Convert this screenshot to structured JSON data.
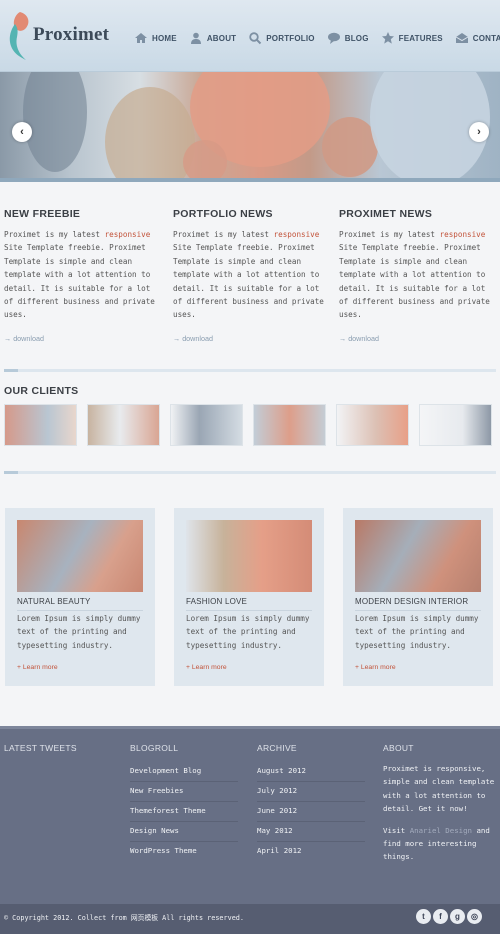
{
  "brand": {
    "name": "Proximet"
  },
  "nav": [
    {
      "label": "HOME",
      "icon": "home-icon"
    },
    {
      "label": "ABOUT",
      "icon": "user-icon"
    },
    {
      "label": "PORTFOLIO",
      "icon": "search-icon"
    },
    {
      "label": "BLOG",
      "icon": "chat-bubble-icon"
    },
    {
      "label": "FEATURES",
      "icon": "star-icon"
    },
    {
      "label": "CONTACT",
      "icon": "envelope-icon"
    }
  ],
  "slider": {
    "prev": "‹",
    "next": "›"
  },
  "columns": [
    {
      "title": "NEW FREEBIE",
      "text_before": "Proximet is my latest ",
      "highlight": "responsive",
      "text_after": " Site Template freebie. Proximet Template is simple and clean template with a lot attention to detail. It is suitable for a lot of different business and private uses.",
      "link": "download"
    },
    {
      "title": "PORTFOLIO NEWS",
      "text_before": "Proximet is my latest ",
      "highlight": "responsive",
      "text_after": " Site Template freebie. Proximet Template is simple and clean template with a lot attention to detail. It is suitable for a lot of different business and private uses.",
      "link": "download"
    },
    {
      "title": "PROXIMET NEWS",
      "text_before": "Proximet is my latest ",
      "highlight": "responsive",
      "text_after": " Site Template freebie. Proximet Template is simple and clean template with a lot attention to detail. It is suitable for a lot of different business and private uses.",
      "link": "download"
    }
  ],
  "clients": {
    "title": "OUR CLIENTS"
  },
  "cards": [
    {
      "title": "NATURAL BEAUTY",
      "text": "Lorem Ipsum is simply dummy text of the printing and typesetting industry.",
      "more": "+ Learn more"
    },
    {
      "title": "FASHION LOVE",
      "text": "Lorem Ipsum is simply dummy text of the printing and typesetting industry.",
      "more": "+ Learn more"
    },
    {
      "title": "MODERN DESIGN INTERIOR",
      "text": "Lorem Ipsum is simply dummy text of the printing and typesetting industry.",
      "more": "+ Learn more"
    }
  ],
  "footer": {
    "tweets_title": "LATEST TWEETS",
    "blogroll": {
      "title": "BLOGROLL",
      "items": [
        "Development Blog",
        "New Freebies",
        "Themeforest Theme",
        "Design News",
        "WordPress Theme"
      ]
    },
    "archive": {
      "title": "ARCHIVE",
      "items": [
        "August 2012",
        "July 2012",
        "June 2012",
        "May 2012",
        "April 2012"
      ]
    },
    "about": {
      "title": "ABOUT",
      "text": "Proximet is responsive, simple and clean template with a lot attention to detail. Get it now!",
      "visit_prefix": "Visit ",
      "visit_name": "Anariel Design",
      "visit_suffix": " and find more interesting things."
    }
  },
  "copyright": "© Copyright 2012. Collect from 网页模板  All rights reserved.",
  "social": [
    {
      "icon": "twitter-icon",
      "glyph": "t"
    },
    {
      "icon": "facebook-icon",
      "glyph": "f"
    },
    {
      "icon": "google-plus-icon",
      "glyph": "g"
    },
    {
      "icon": "dribbble-icon",
      "glyph": "◎"
    }
  ]
}
